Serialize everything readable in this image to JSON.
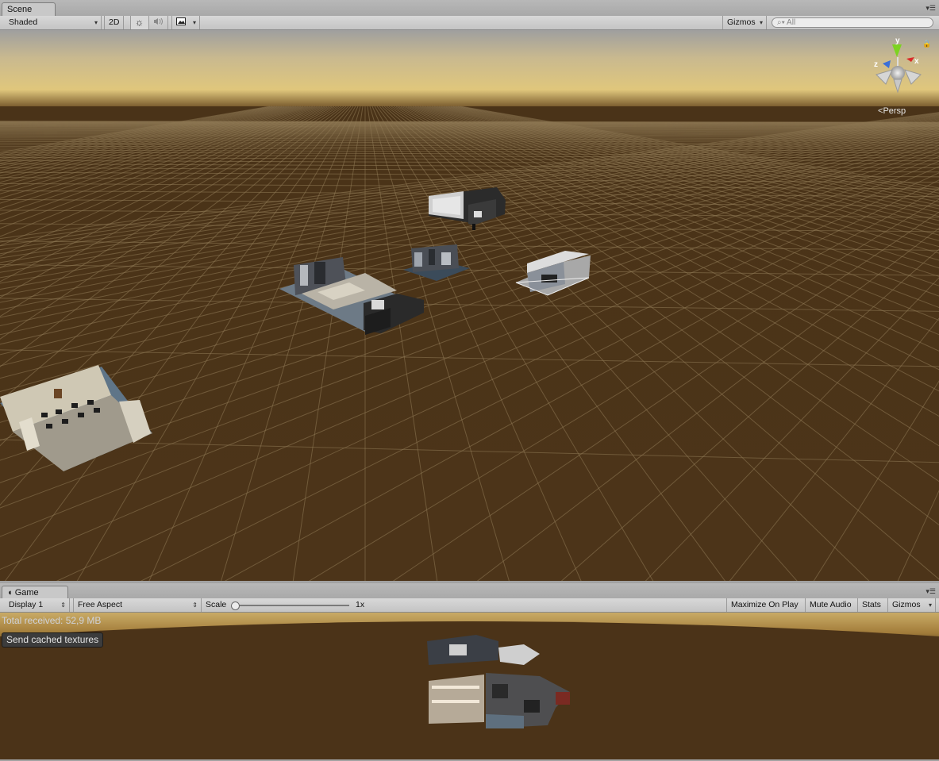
{
  "scene": {
    "tab_label": "Scene",
    "toolbar": {
      "shading_mode": "Shaded",
      "mode_2d": "2D",
      "sun_icon": "sun-icon",
      "audio_icon": "speaker-icon",
      "effects_icon": "image-icon",
      "gizmos_label": "Gizmos",
      "search_placeholder": "All"
    },
    "gizmo": {
      "y_label": "y",
      "x_label": "x",
      "z_label": "z",
      "projection_label": "Persp"
    }
  },
  "game": {
    "tab_label": "Game",
    "tab_icon": "pacman-icon",
    "toolbar": {
      "display": "Display 1",
      "aspect": "Free Aspect",
      "scale_label": "Scale",
      "scale_value": "1x",
      "maximize_on_play": "Maximize On Play",
      "mute_audio": "Mute Audio",
      "stats": "Stats",
      "gizmos": "Gizmos"
    },
    "total_received": "Total received: 52,9 MB",
    "send_button": "Send cached textures"
  },
  "colors": {
    "ground": "#4c3419",
    "sky_glow": "#d8c07a",
    "toolbar": "#cbcbcb"
  }
}
